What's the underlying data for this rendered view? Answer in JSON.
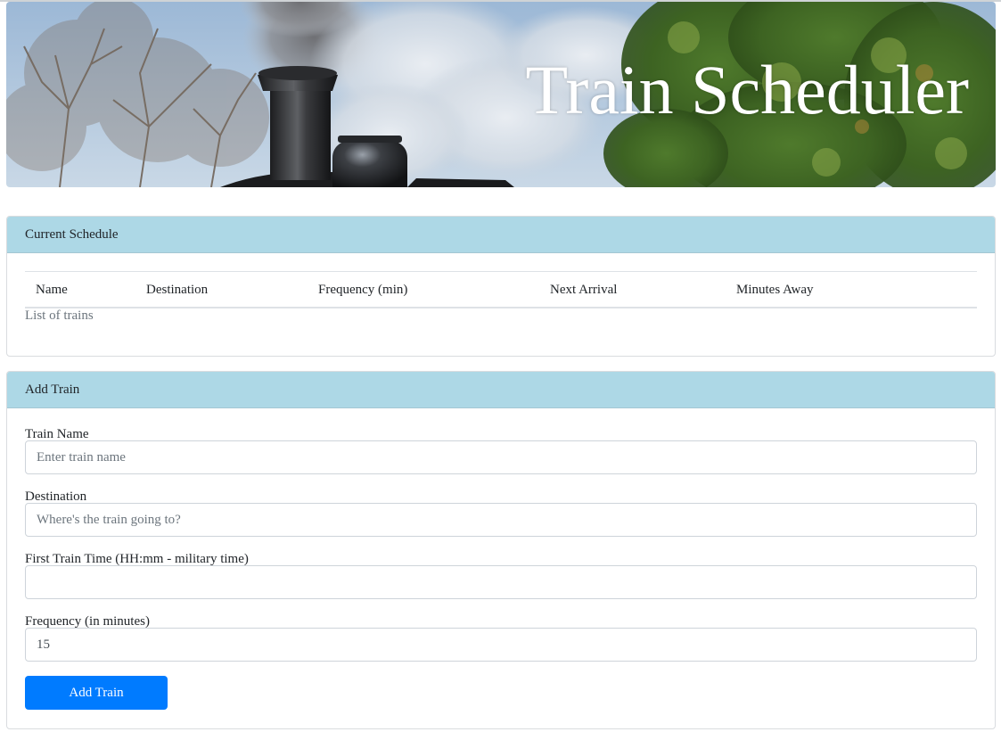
{
  "banner": {
    "title": "Train Scheduler"
  },
  "schedule": {
    "header": "Current Schedule",
    "columns": [
      "Name",
      "Destination",
      "Frequency (min)",
      "Next Arrival",
      "Minutes Away"
    ],
    "caption": "List of trains"
  },
  "add_train": {
    "header": "Add Train",
    "fields": [
      {
        "label": "Train Name",
        "value": "",
        "placeholder": "Enter train name"
      },
      {
        "label": "Destination",
        "value": "",
        "placeholder": "Where's the train going to?"
      },
      {
        "label": "First Train Time (HH:mm - military time)",
        "value": "",
        "placeholder": ""
      },
      {
        "label": "Frequency (in minutes)",
        "value": "15",
        "placeholder": ""
      }
    ],
    "submit_label": "Add Train"
  },
  "colors": {
    "card_header": "#add8e6",
    "button": "#007bff"
  }
}
